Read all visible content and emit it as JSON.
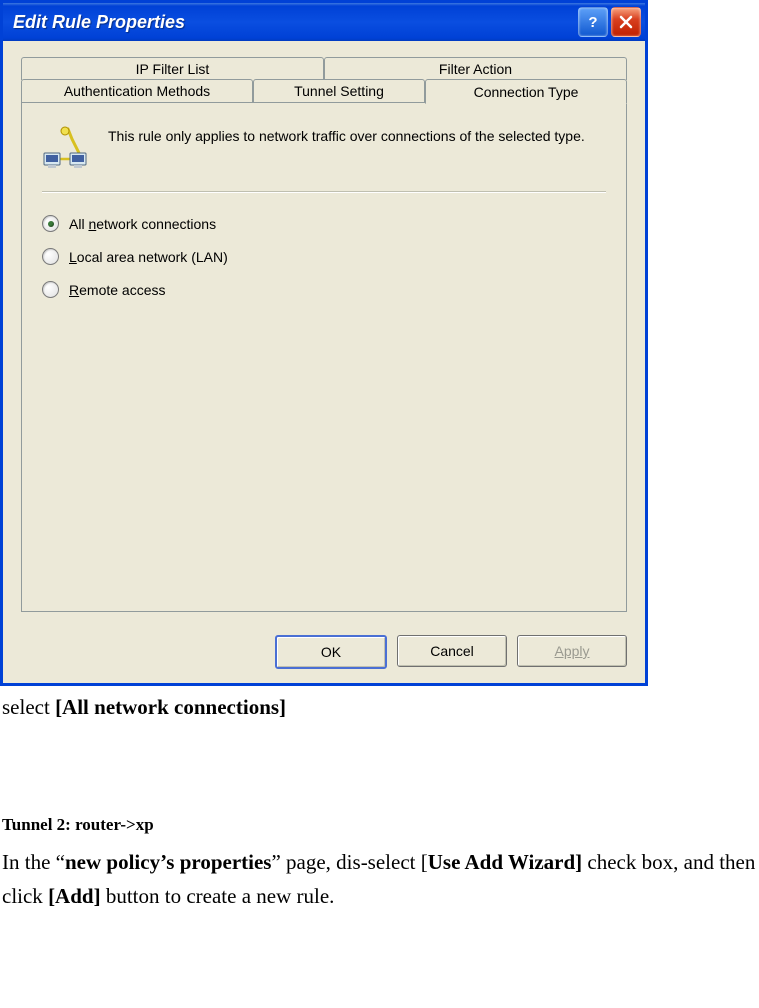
{
  "window": {
    "title": "Edit Rule Properties"
  },
  "tabs": {
    "row1": [
      "IP Filter List",
      "Filter Action"
    ],
    "row2": [
      "Authentication Methods",
      "Tunnel Setting",
      "Connection Type"
    ]
  },
  "info_text": "This rule only applies to network traffic over connections of the selected type.",
  "radios": {
    "opt1_pre": "All ",
    "opt1_ul": "n",
    "opt1_post": "etwork connections",
    "opt2_ul": "L",
    "opt2_post": "ocal area network (LAN)",
    "opt3_ul": "R",
    "opt3_post": "emote access"
  },
  "buttons": {
    "ok": "OK",
    "cancel": "Cancel",
    "apply": "Apply"
  },
  "doc": {
    "line1_pre": "select ",
    "line1_bold": "[All network connections]",
    "heading": "Tunnel 2: router->xp",
    "line2_a": "In the “",
    "line2_b": "new policy’s properties",
    "line2_c": "” page, dis-select [",
    "line2_d": "Use Add Wizard]",
    "line2_e": " check box, and then click ",
    "line2_f": "[Add]",
    "line2_g": " button to create a new rule."
  }
}
